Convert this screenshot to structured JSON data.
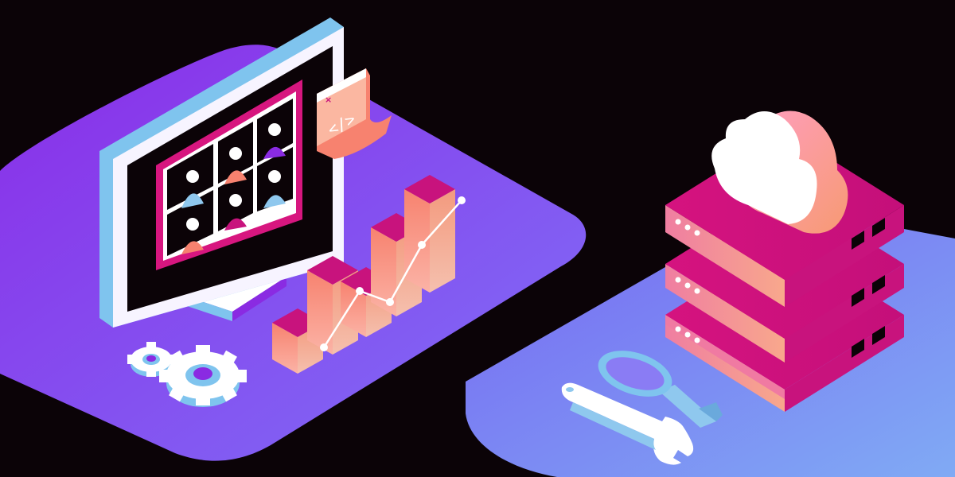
{
  "illustration": {
    "palette": {
      "background": "#0b0307",
      "platform_left_top": "#8a3cf0",
      "platform_left_bottom": "#7f67f5",
      "platform_right_left": "#7a6bf2",
      "platform_right_right": "#7fa7f3",
      "monitor_frame": "#f7f4ff",
      "monitor_edge": "#7fc4ee",
      "monitor_screen": "#0b0307",
      "grid_border": "#d7167f",
      "pink": "#c8137d",
      "peach": "#f79a7a",
      "light_blue": "#8fc8ee",
      "purple": "#8a2be2",
      "white": "#ffffff"
    },
    "code_window_glyph": "</>",
    "icons": [
      "desktop-monitor-icon",
      "video-call-grid-icon",
      "code-window-icon",
      "bar-chart-growth-icon",
      "trend-line-icon",
      "gear-icon",
      "cloud-icon",
      "server-rack-icon",
      "magnifier-icon",
      "wrench-icon"
    ],
    "chart_growth_trend": [
      1,
      4,
      3,
      6,
      8
    ]
  }
}
